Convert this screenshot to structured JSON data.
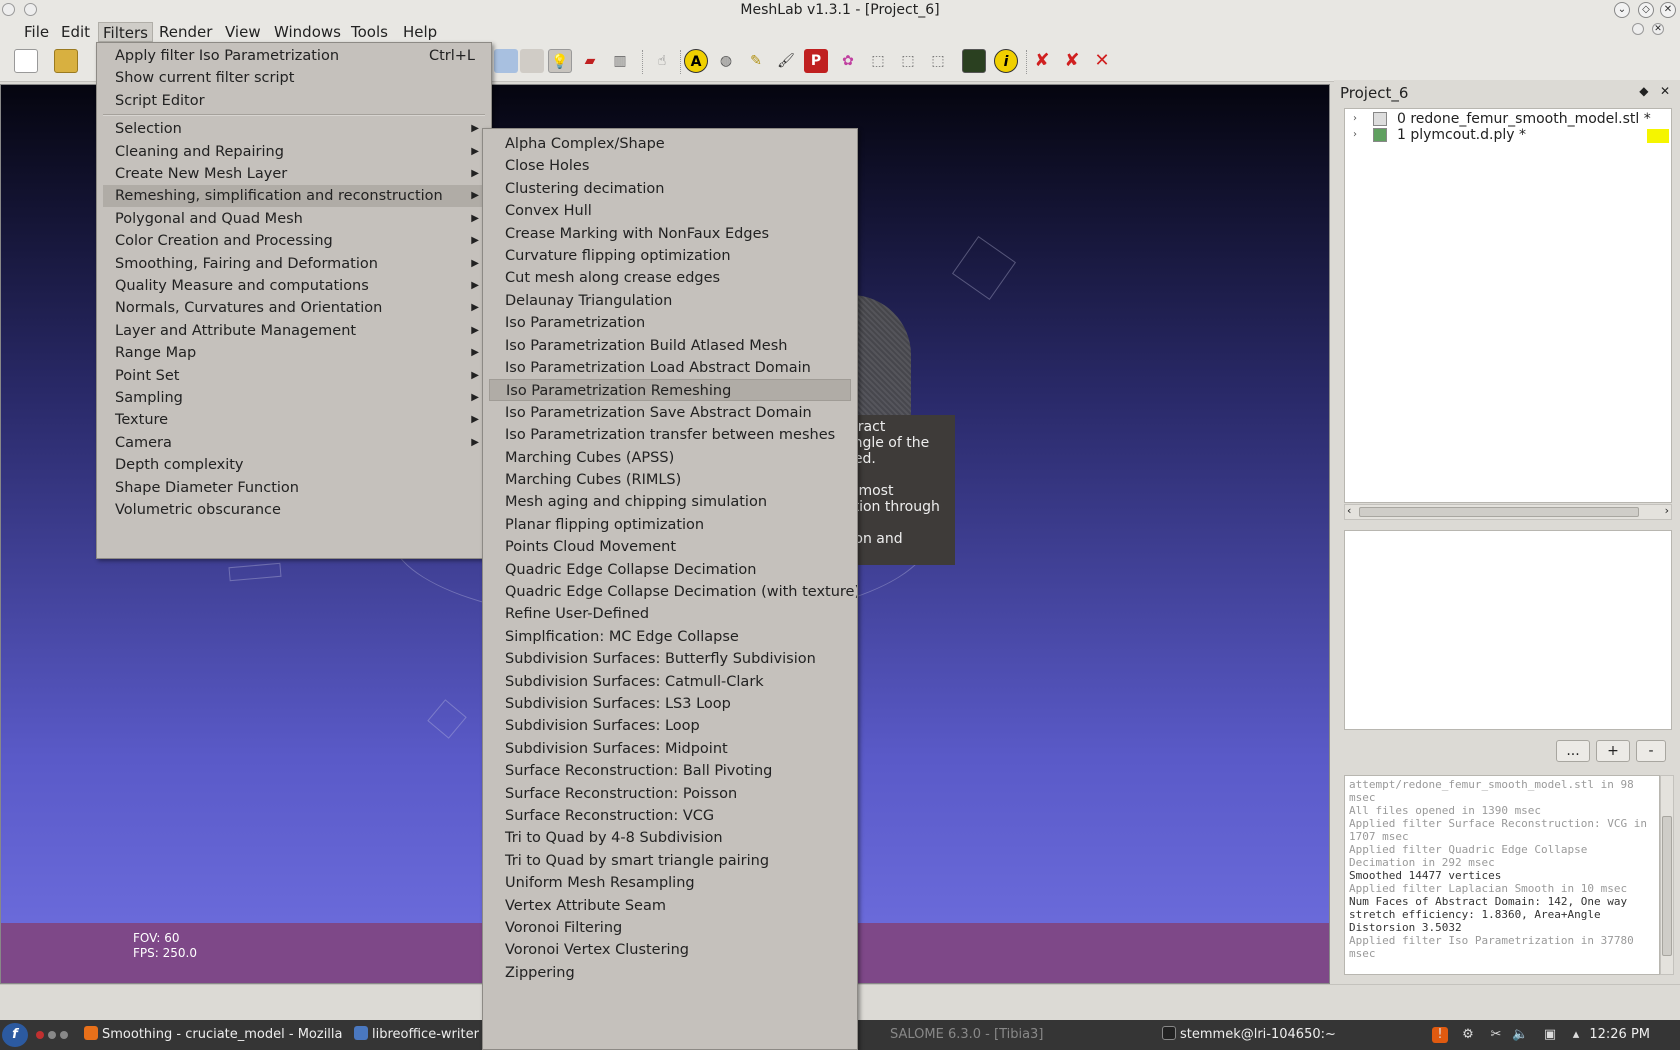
{
  "window": {
    "title": "MeshLab v1.3.1 - [Project_6]"
  },
  "menubar": [
    {
      "label": "File",
      "active": false
    },
    {
      "label": "Edit",
      "active": false
    },
    {
      "label": "Filters",
      "active": true
    },
    {
      "label": "Render",
      "active": false
    },
    {
      "label": "View",
      "active": false
    },
    {
      "label": "Windows",
      "active": false
    },
    {
      "label": "Tools",
      "active": false
    },
    {
      "label": "Help",
      "active": false
    }
  ],
  "filters_menu": {
    "top_items": [
      {
        "label": "Apply filter Iso Parametrization",
        "shortcut": "Ctrl+L"
      },
      {
        "label": "Show current filter script"
      },
      {
        "label": "Script Editor"
      }
    ],
    "categories": [
      {
        "label": "Selection",
        "submenu": true
      },
      {
        "label": "Cleaning and Repairing",
        "submenu": true
      },
      {
        "label": "Create New Mesh Layer",
        "submenu": true
      },
      {
        "label": "Remeshing, simplification and reconstruction",
        "submenu": true,
        "highlighted": true
      },
      {
        "label": "Polygonal and Quad Mesh",
        "submenu": true
      },
      {
        "label": "Color Creation and Processing",
        "submenu": true
      },
      {
        "label": "Smoothing, Fairing and Deformation",
        "submenu": true
      },
      {
        "label": "Quality Measure and computations",
        "submenu": true
      },
      {
        "label": "Normals, Curvatures and Orientation",
        "submenu": true
      },
      {
        "label": "Layer and Attribute Management",
        "submenu": true
      },
      {
        "label": "Range Map",
        "submenu": true
      },
      {
        "label": "Point Set",
        "submenu": true
      },
      {
        "label": "Sampling",
        "submenu": true
      },
      {
        "label": "Texture",
        "submenu": true
      },
      {
        "label": "Camera",
        "submenu": true
      },
      {
        "label": "Depth complexity",
        "submenu": false
      },
      {
        "label": "Shape Diameter Function",
        "submenu": false
      },
      {
        "label": "Volumetric obscurance",
        "submenu": false
      }
    ]
  },
  "remesh_submenu": [
    {
      "label": "Alpha Complex/Shape"
    },
    {
      "label": "Close Holes"
    },
    {
      "label": "Clustering decimation"
    },
    {
      "label": "Convex Hull"
    },
    {
      "label": "Crease Marking with NonFaux Edges"
    },
    {
      "label": "Curvature flipping optimization"
    },
    {
      "label": "Cut mesh along crease edges"
    },
    {
      "label": "Delaunay Triangulation"
    },
    {
      "label": "Iso Parametrization"
    },
    {
      "label": "Iso Parametrization Build Atlased Mesh"
    },
    {
      "label": "Iso Parametrization Load Abstract Domain"
    },
    {
      "label": "Iso Parametrization Remeshing",
      "highlighted": true
    },
    {
      "label": "Iso Parametrization Save Abstract Domain"
    },
    {
      "label": "Iso Parametrization transfer between meshes"
    },
    {
      "label": "Marching Cubes (APSS)"
    },
    {
      "label": "Marching Cubes (RIMLS)"
    },
    {
      "label": "Mesh aging and chipping simulation"
    },
    {
      "label": "Planar flipping optimization"
    },
    {
      "label": "Points Cloud Movement"
    },
    {
      "label": "Quadric Edge Collapse Decimation"
    },
    {
      "label": "Quadric Edge Collapse Decimation (with texture)"
    },
    {
      "label": "Refine User-Defined"
    },
    {
      "label": "Simplfication: MC Edge Collapse"
    },
    {
      "label": "Subdivision Surfaces: Butterfly Subdivision"
    },
    {
      "label": "Subdivision Surfaces: Catmull-Clark"
    },
    {
      "label": "Subdivision Surfaces: LS3 Loop"
    },
    {
      "label": "Subdivision Surfaces: Loop"
    },
    {
      "label": "Subdivision Surfaces: Midpoint"
    },
    {
      "label": "Surface Reconstruction: Ball Pivoting"
    },
    {
      "label": "Surface Reconstruction: Poisson"
    },
    {
      "label": "Surface Reconstruction: VCG"
    },
    {
      "label": "Tri to Quad by 4-8 Subdivision"
    },
    {
      "label": "Tri to Quad by smart triangle pairing"
    },
    {
      "label": "Uniform Mesh Resampling"
    },
    {
      "label": "Vertex Attribute Seam"
    },
    {
      "label": "Voronoi Filtering"
    },
    {
      "label": "Voronoi Vertex Clustering"
    },
    {
      "label": "Zippering"
    }
  ],
  "tooltip": {
    "lines": [
      "stract",
      "angle of the",
      "ded.",
      "",
      "Almost",
      "ation through",
      "",
      "tion and"
    ]
  },
  "viewport": {
    "fov": "FOV: 60",
    "fps": "FPS:  250.0"
  },
  "right_panel": {
    "title": "Project_6",
    "layers": [
      {
        "label": "0  redone_femur_smooth_model.stl *"
      },
      {
        "label": "1  plymcout.d.ply *"
      }
    ],
    "layer_swatch_color": "#f5f500",
    "buttons": [
      "...",
      "+",
      "-"
    ],
    "log": [
      {
        "text": "attempt/redone_femur_smooth_model.stl in 98 msec",
        "style": "dim"
      },
      {
        "text": "All files opened in 1390 msec",
        "style": "dim"
      },
      {
        "text": "Applied filter Surface Reconstruction: VCG in 1707 msec",
        "style": "dim"
      },
      {
        "text": "Applied filter Quadric Edge Collapse Decimation in 292 msec",
        "style": "dim"
      },
      {
        "text": "Smoothed 14477 vertices",
        "style": "dark"
      },
      {
        "text": "Applied filter Laplacian Smooth in 10 msec",
        "style": "dim"
      },
      {
        "text": "Num Faces of Abstract Domain: 142, One way stretch efficiency: 1.8360, Area+Angle Distorsion 3.5032",
        "style": "dark"
      },
      {
        "text": "Applied filter Iso Parametrization in 37780 msec",
        "style": "dim"
      }
    ]
  },
  "taskbar": {
    "tasks": [
      {
        "label": "Smoothing - cruciate_model - Mozilla",
        "icon_color": "#e8701a"
      },
      {
        "label": "libreoffice-writer",
        "icon_color": "#4a78c0"
      },
      {
        "label": "SALOME 6.3.0 - [Tibia3]",
        "icon_color": "#666666",
        "dimmed": true
      },
      {
        "label": "stemmek@lri-104650:~",
        "icon_color": "#333333"
      }
    ],
    "clock": "12:26 PM"
  },
  "colors": {
    "menu_bg": "#c5c1bc",
    "menu_highlight": "#b0aca6",
    "viewport_bottom": "#7e4888",
    "taskbar": "#353535"
  }
}
